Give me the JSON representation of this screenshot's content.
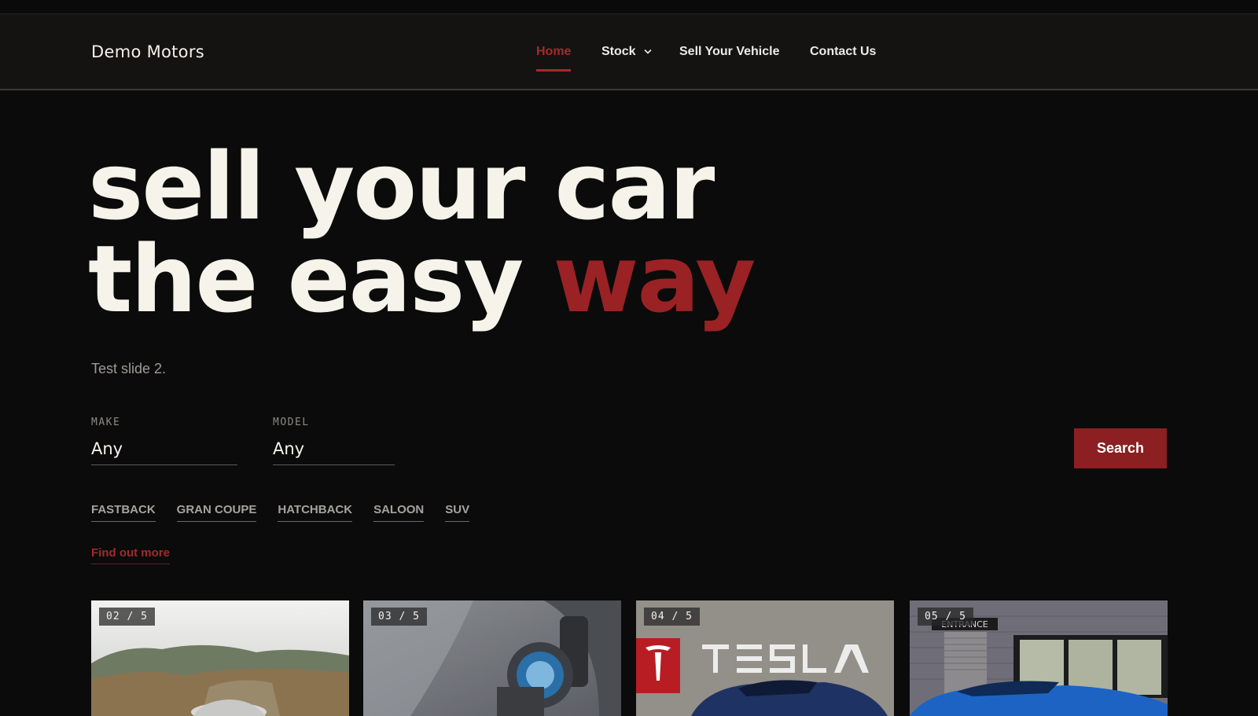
{
  "header": {
    "logo": "Demo Motors",
    "nav": [
      {
        "label": "Home",
        "active": true
      },
      {
        "label": "Stock",
        "has_dropdown": true
      },
      {
        "label": "Sell Your Vehicle"
      },
      {
        "label": "Contact Us"
      }
    ]
  },
  "hero": {
    "line1": "sell your car",
    "line2_main": "the easy ",
    "line2_accent": "way",
    "subtitle": "Test slide 2."
  },
  "search": {
    "make_label": "MAKE",
    "make_value": "Any",
    "model_label": "MODEL",
    "model_value": "Any",
    "button": "Search"
  },
  "body_types": [
    "FASTBACK",
    "GRAN COUPE",
    "HATCHBACK",
    "SALOON",
    "SUV"
  ],
  "find_more": "Find out more",
  "slides": [
    {
      "counter": "02 / 5",
      "image": "silver-car-on-misty-hillside-road"
    },
    {
      "counter": "03 / 5",
      "image": "electric-car-charging-port"
    },
    {
      "counter": "04 / 5",
      "image": "tesla-showroom-sign-blue-car",
      "sign_text": "TESLA"
    },
    {
      "counter": "05 / 5",
      "image": "blue-coupe-by-warehouse-entrance",
      "sign_text": "ENTRANCE"
    }
  ],
  "colors": {
    "accent": "#9a2224",
    "background": "#0b0b0b",
    "header": "#141312",
    "text": "#f6f3ea"
  }
}
